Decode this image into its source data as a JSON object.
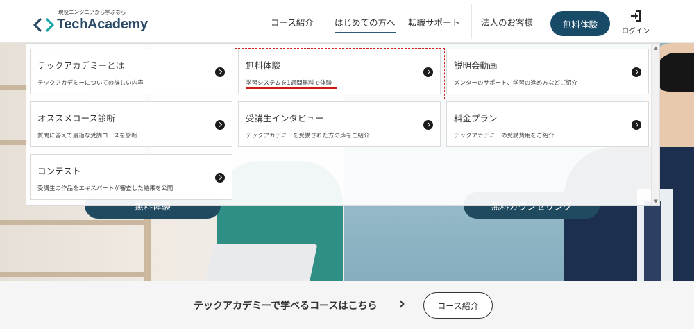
{
  "header": {
    "logo_tagline": "現役エンジニアから学ぶなら",
    "logo_text": "TechAcademy",
    "nav": [
      {
        "label": "コース紹介",
        "active": false
      },
      {
        "label": "はじめての方へ",
        "active": true
      },
      {
        "label": "転職サポート",
        "active": false
      },
      {
        "label": "法人のお客様",
        "active": false
      }
    ],
    "trial_button": "無料体験",
    "login_label": "ログイン"
  },
  "dropdown": {
    "cards": [
      {
        "title": "テックアカデミーとは",
        "desc": "テックアカデミーについての詳しい内容"
      },
      {
        "title": "無料体験",
        "desc": "学習システムを1週間無料で体験"
      },
      {
        "title": "説明会動画",
        "desc": "メンターのサポート、学習の進め方などご紹介"
      },
      {
        "title": "オススメコース診断",
        "desc": "質問に答えて最適な受講コースを診断"
      },
      {
        "title": "受講生インタビュー",
        "desc": "テックアカデミーを受講された方の声をご紹介"
      },
      {
        "title": "料金プラン",
        "desc": "テックアカデミーの受講費用をご紹介"
      },
      {
        "title": "コンテスト",
        "desc": "受講生の作品をエキスパートが審査した結果を公開"
      }
    ]
  },
  "hero": {
    "left_button": "無料体験",
    "right_button": "無料カウンセリング"
  },
  "bottom": {
    "text": "テックアカデミーで学べるコースはこちら",
    "button": "コース紹介"
  },
  "colors": {
    "brand_navy": "#184b68",
    "highlight_red": "#d02020",
    "logo_teal": "#1aa5a5"
  }
}
